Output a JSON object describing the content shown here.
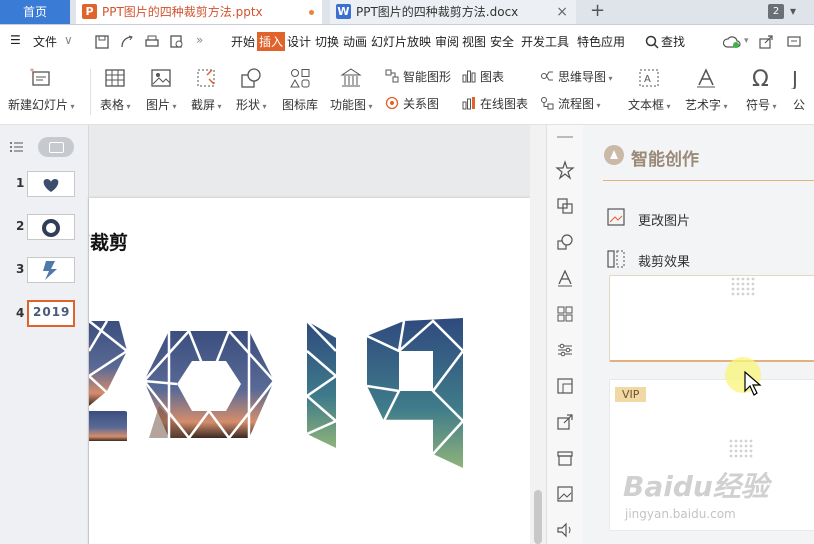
{
  "tabs": {
    "home": "首页",
    "pptx": "PPT图片的四种裁剪方法.pptx",
    "docx": "PPT图片的四种裁剪方法.docx",
    "count": "2"
  },
  "menu": {
    "file": "文件",
    "items": [
      "开始",
      "插入",
      "设计",
      "切换",
      "动画",
      "幻灯片放映",
      "审阅",
      "视图",
      "安全",
      "开发工具",
      "特色应用"
    ],
    "search": "查找"
  },
  "ribbon": {
    "new_slide": "新建幻灯片",
    "table": "表格",
    "picture": "图片",
    "screenshot": "截屏",
    "shape": "形状",
    "icon_lib": "图标库",
    "func_chart": "功能图",
    "smart_art": "智能图形",
    "chart": "图表",
    "relation": "关系图",
    "online_chart": "在线图表",
    "mind_map": "思维导图",
    "flow_chart": "流程图",
    "text_box": "文本框",
    "art_text": "艺术字",
    "symbol": "符号",
    "formula": "公"
  },
  "thumbnails": {
    "numbers": [
      "1",
      "2",
      "3",
      "4"
    ],
    "slide4_label": "2019"
  },
  "slide": {
    "title_fragment": "剪裁剪",
    "big_text": "2019"
  },
  "right_panel": {
    "title": "智能创作",
    "change_picture": "更改图片",
    "crop_effect": "裁剪效果",
    "vip": "VIP"
  },
  "watermark": {
    "brand": "Baidu经验",
    "url": "jingyan.baidu.com"
  },
  "colors": {
    "accent": "#e0632c",
    "home_tab": "#3a7bd5",
    "panel_title": "#9b8a78"
  }
}
